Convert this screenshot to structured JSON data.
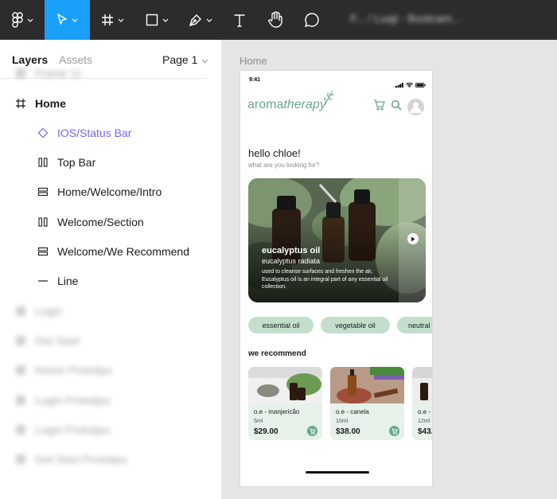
{
  "toolbar": {
    "doc_title": "F... / Luaji - Bootcam..."
  },
  "panel": {
    "tabs": {
      "layers": "Layers",
      "assets": "Assets"
    },
    "page_selector": "Page 1",
    "layers": [
      {
        "label": "Frame 11",
        "icon": "frame-icon",
        "blurred": true
      },
      {
        "label": "Home",
        "icon": "frame-icon",
        "blurred": false
      },
      {
        "label": "IOS/Status Bar",
        "icon": "component-instance-icon",
        "blurred": false
      },
      {
        "label": "Top Bar",
        "icon": "horizontal-layout-icon",
        "blurred": false
      },
      {
        "label": "Home/Welcome/Intro",
        "icon": "vertical-layout-icon",
        "blurred": false
      },
      {
        "label": "Welcome/Section",
        "icon": "horizontal-layout-icon",
        "blurred": false
      },
      {
        "label": "Welcome/We Recommend",
        "icon": "vertical-layout-icon",
        "blurred": false
      },
      {
        "label": "Line",
        "icon": "line-icon",
        "blurred": false
      },
      {
        "label": "Login",
        "icon": "frame-icon",
        "blurred": true
      },
      {
        "label": "Get Start",
        "icon": "frame-icon",
        "blurred": true
      },
      {
        "label": "Home Prototipo",
        "icon": "frame-icon",
        "blurred": true
      },
      {
        "label": "Login Prototipo",
        "icon": "frame-icon",
        "blurred": true
      },
      {
        "label": "Login Prototipo",
        "icon": "frame-icon",
        "blurred": true
      },
      {
        "label": "Get Start Prototipo",
        "icon": "frame-icon",
        "blurred": true
      }
    ]
  },
  "canvas": {
    "frame_label": "Home",
    "phone": {
      "status_time": "9:41",
      "logo": {
        "part1": "aroma",
        "part2": "therapy"
      },
      "greeting": "hello chloe!",
      "greeting_sub": "what are you looking for?",
      "hero": {
        "title": "eucalyptus oil",
        "subtitle": "eucalyptus radiata",
        "description": "used to cleanse surfaces and freshen the air, Eucalyptus oil is an integral part of any essential oil collection."
      },
      "chips": [
        "essential oil",
        "vegetable oil",
        "neutral"
      ],
      "recommend_title": "we recommend",
      "products": [
        {
          "name": "o.e - manjericão",
          "size": "5ml",
          "price": "$29.00"
        },
        {
          "name": "o.e - canela",
          "size": "10ml",
          "price": "$38.00"
        },
        {
          "name": "o.e - ",
          "size": "12ml",
          "price": "$43."
        }
      ]
    }
  },
  "colors": {
    "toolbar_bg": "#2c2c2c",
    "active_tool": "#18a0fb",
    "brand_green": "#6aa889",
    "chip_green": "#c3dfcc",
    "card_green": "#e6f1ea",
    "component_purple": "#7b61ff"
  }
}
